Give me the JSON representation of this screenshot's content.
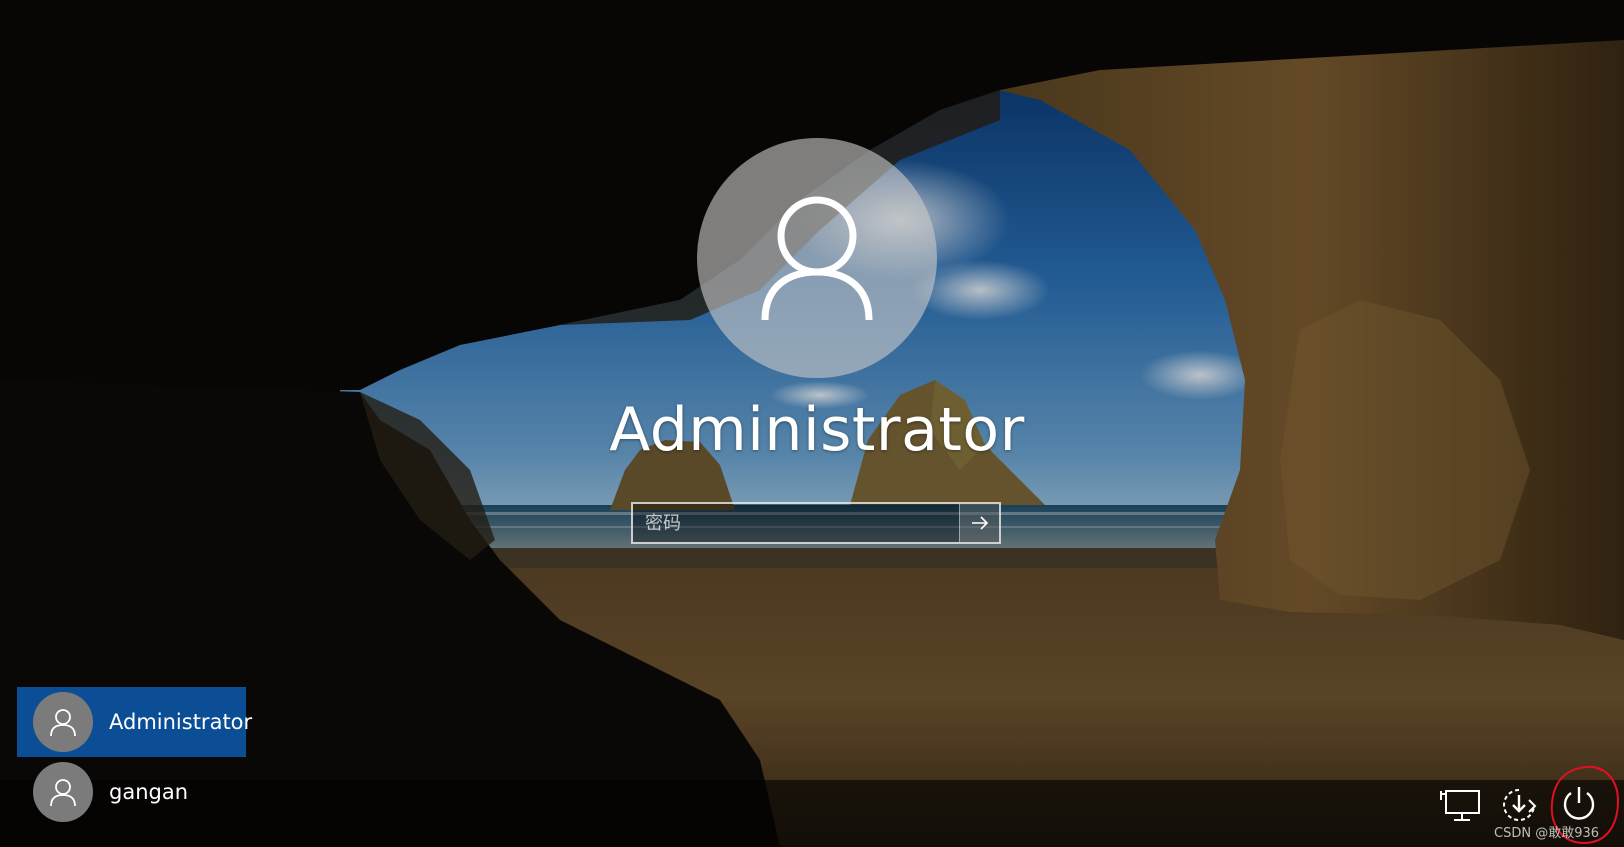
{
  "login": {
    "username": "Administrator",
    "password_placeholder": "密码"
  },
  "users": [
    {
      "name": "Administrator",
      "selected": true
    },
    {
      "name": "gangan",
      "selected": false
    }
  ],
  "tray": {
    "icons": [
      "network-icon",
      "accessibility-icon",
      "power-icon"
    ]
  },
  "watermark": "CSDN @敢敢936",
  "colors": {
    "selected_tile": "#0c4e96",
    "highlight_circle": "#e01020"
  }
}
